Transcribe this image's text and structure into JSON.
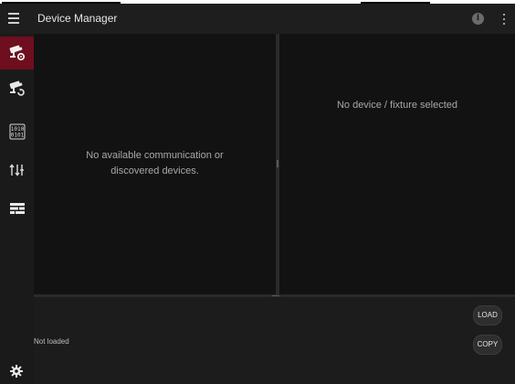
{
  "app": {
    "title": "Device Manager"
  },
  "appbar": {
    "menu_icon": "hamburger-menu-icon",
    "info_icon": "info-icon",
    "info_glyph": "i",
    "more_icon": "more-vert-icon"
  },
  "sidebar": {
    "items": [
      {
        "name": "device-settings",
        "icon": "camera-gear-icon",
        "active": true
      },
      {
        "name": "device-discovery",
        "icon": "camera-refresh-icon",
        "active": false
      },
      {
        "name": "binary-data",
        "icon": "binary-icon",
        "active": false
      },
      {
        "name": "sort-order",
        "icon": "sort-arrows-icon",
        "active": false
      },
      {
        "name": "table-view",
        "icon": "table-rows-icon",
        "active": false
      }
    ],
    "settings_icon": "gear-icon"
  },
  "panels": {
    "left_empty_line1": "No available communication or",
    "left_empty_line2": "discovered devices.",
    "right_empty": "No device / fixture selected"
  },
  "bottom": {
    "status": "Not loaded",
    "load_label": "LOAD",
    "copy_label": "COPY"
  },
  "colors": {
    "active_accent": "#6e0e1e",
    "app_background": "#121212"
  }
}
